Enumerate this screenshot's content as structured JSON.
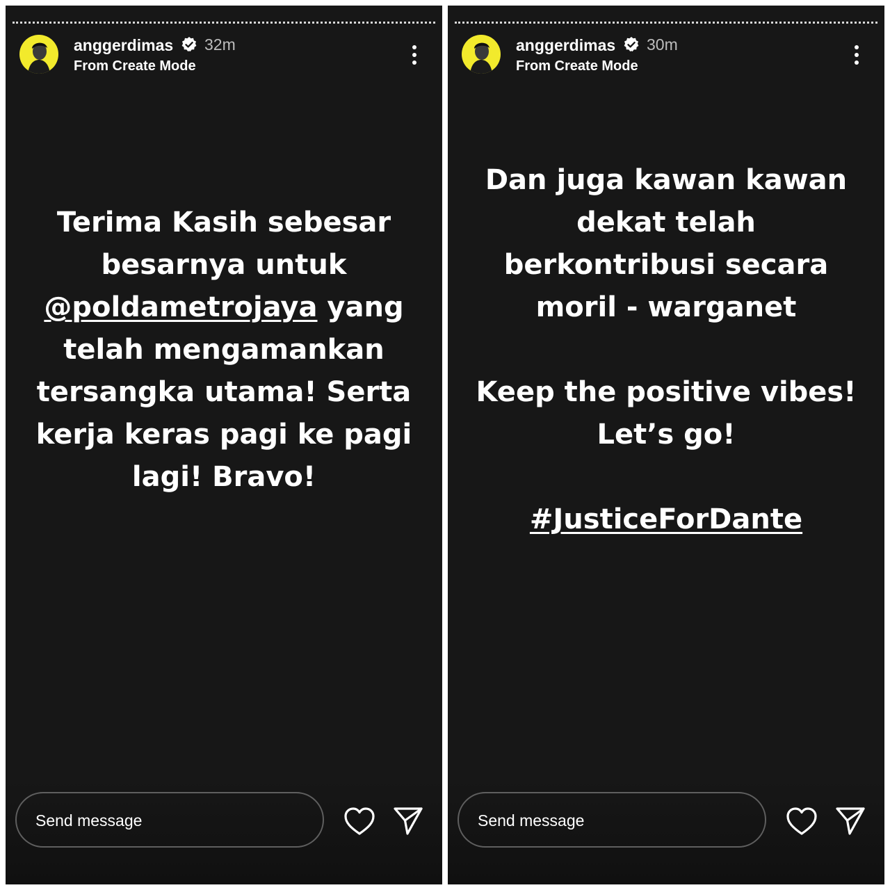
{
  "colors": {
    "story_bg": "#171717",
    "avatar_bg": "#f2ea2c",
    "text": "#ffffff",
    "time": "#bdbdbd",
    "input_border": "#5f5f5f"
  },
  "stories": [
    {
      "username": "anggerdimas",
      "time_ago": "32m",
      "subtitle": "From Create Mode",
      "more_icon": "more-vertical-icon",
      "body": {
        "l1": "Terima Kasih sebesar",
        "l2": "besarnya untuk",
        "l3_mention": "@poldametrojaya",
        "l3_rest": " yang",
        "l4": "telah mengamankan",
        "l5": "tersangka utama! Serta",
        "l6": "kerja keras pagi ke pagi",
        "l7": "lagi! Bravo!"
      },
      "message_placeholder": "Send message",
      "like_icon": "heart-icon",
      "share_icon": "send-icon"
    },
    {
      "username": "anggerdimas",
      "time_ago": "30m",
      "subtitle": "From Create Mode",
      "more_icon": "more-vertical-icon",
      "body": {
        "l1": "Dan juga kawan kawan",
        "l2": "dekat telah",
        "l3": "berkontribusi secara",
        "l4": "moril - warganet",
        "l5": "Keep the positive vibes!",
        "l6": "Let’s go!",
        "hashtag": "#JusticeForDante"
      },
      "message_placeholder": "Send message",
      "like_icon": "heart-icon",
      "share_icon": "send-icon"
    }
  ]
}
